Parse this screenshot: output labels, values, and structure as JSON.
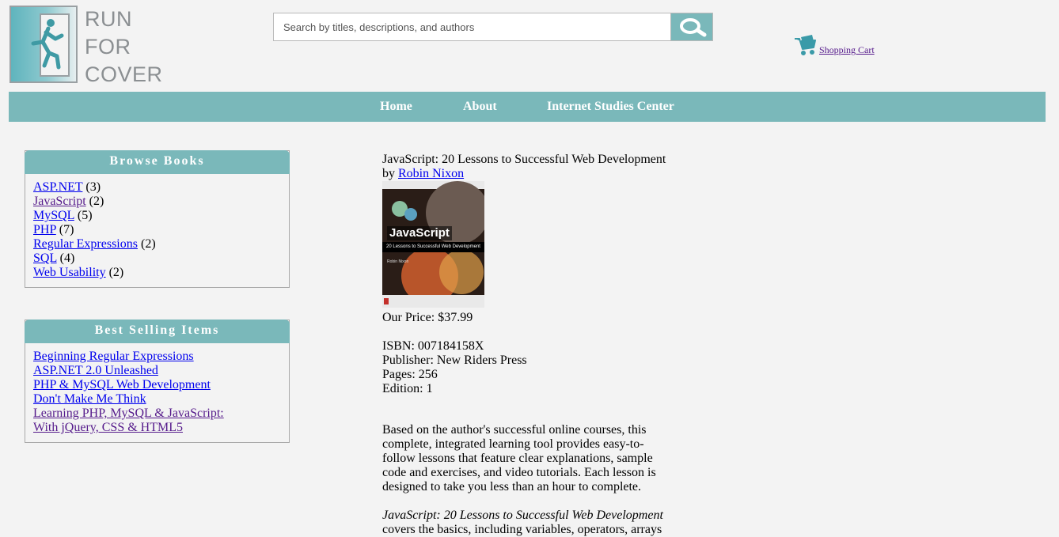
{
  "logo": {
    "line1": "RUN",
    "line2": "FOR",
    "line3": "COVER"
  },
  "search": {
    "placeholder": "Search by titles, descriptions, and authors",
    "value": "",
    "icon": "magnifier-icon"
  },
  "cart": {
    "label": "Shopping Cart",
    "icon": "cart-icon"
  },
  "nav": {
    "items": [
      "Home",
      "About",
      "Internet Studies Center"
    ]
  },
  "browse": {
    "title": "Browse Books",
    "items": [
      {
        "label": "ASP.NET",
        "count": "(3)"
      },
      {
        "label": "JavaScript",
        "count": "(2)"
      },
      {
        "label": "MySQL",
        "count": "(5)"
      },
      {
        "label": "PHP",
        "count": "(7)"
      },
      {
        "label": "Regular Expressions",
        "count": "(2)"
      },
      {
        "label": "SQL",
        "count": "(4)"
      },
      {
        "label": "Web Usability",
        "count": "(2)"
      }
    ]
  },
  "bestselling": {
    "title": "Best Selling Items",
    "items": [
      "Beginning Regular Expressions",
      "ASP.NET 2.0 Unleashed",
      "PHP & MySQL Web Development",
      "Don't Make Me Think",
      "Learning PHP, MySQL & JavaScript: With jQuery, CSS & HTML5"
    ]
  },
  "book": {
    "title": "JavaScript: 20 Lessons to Successful Web Development",
    "by": "by",
    "author": "Robin Nixon",
    "cover": {
      "brand": "JavaScript",
      "subtitle": "20 Lessons to Successful Web Development",
      "author": "Robin Nixon"
    },
    "price_label": "Our Price:",
    "price": "$37.99",
    "isbn_label": "ISBN:",
    "isbn": "007184158X",
    "publisher_label": "Publisher:",
    "publisher": "New Riders Press",
    "pages_label": "Pages:",
    "pages": "256",
    "edition_label": "Edition:",
    "edition": "1",
    "description": "Based on the author's successful online courses, this complete, integrated learning tool provides easy-to-follow lessons that feature clear explanations, sample code and exercises, and video tutorials. Each lesson is designed to take you less than an hour to complete.",
    "description2_title": "JavaScript: 20 Lessons to Successful Web Development",
    "description2_rest": "covers the basics, including variables, operators, arrays"
  },
  "colors": {
    "accent": "#7ab8ba",
    "link": "#0000ee",
    "visited": "#551a8b",
    "background": "#f3f3f3"
  }
}
